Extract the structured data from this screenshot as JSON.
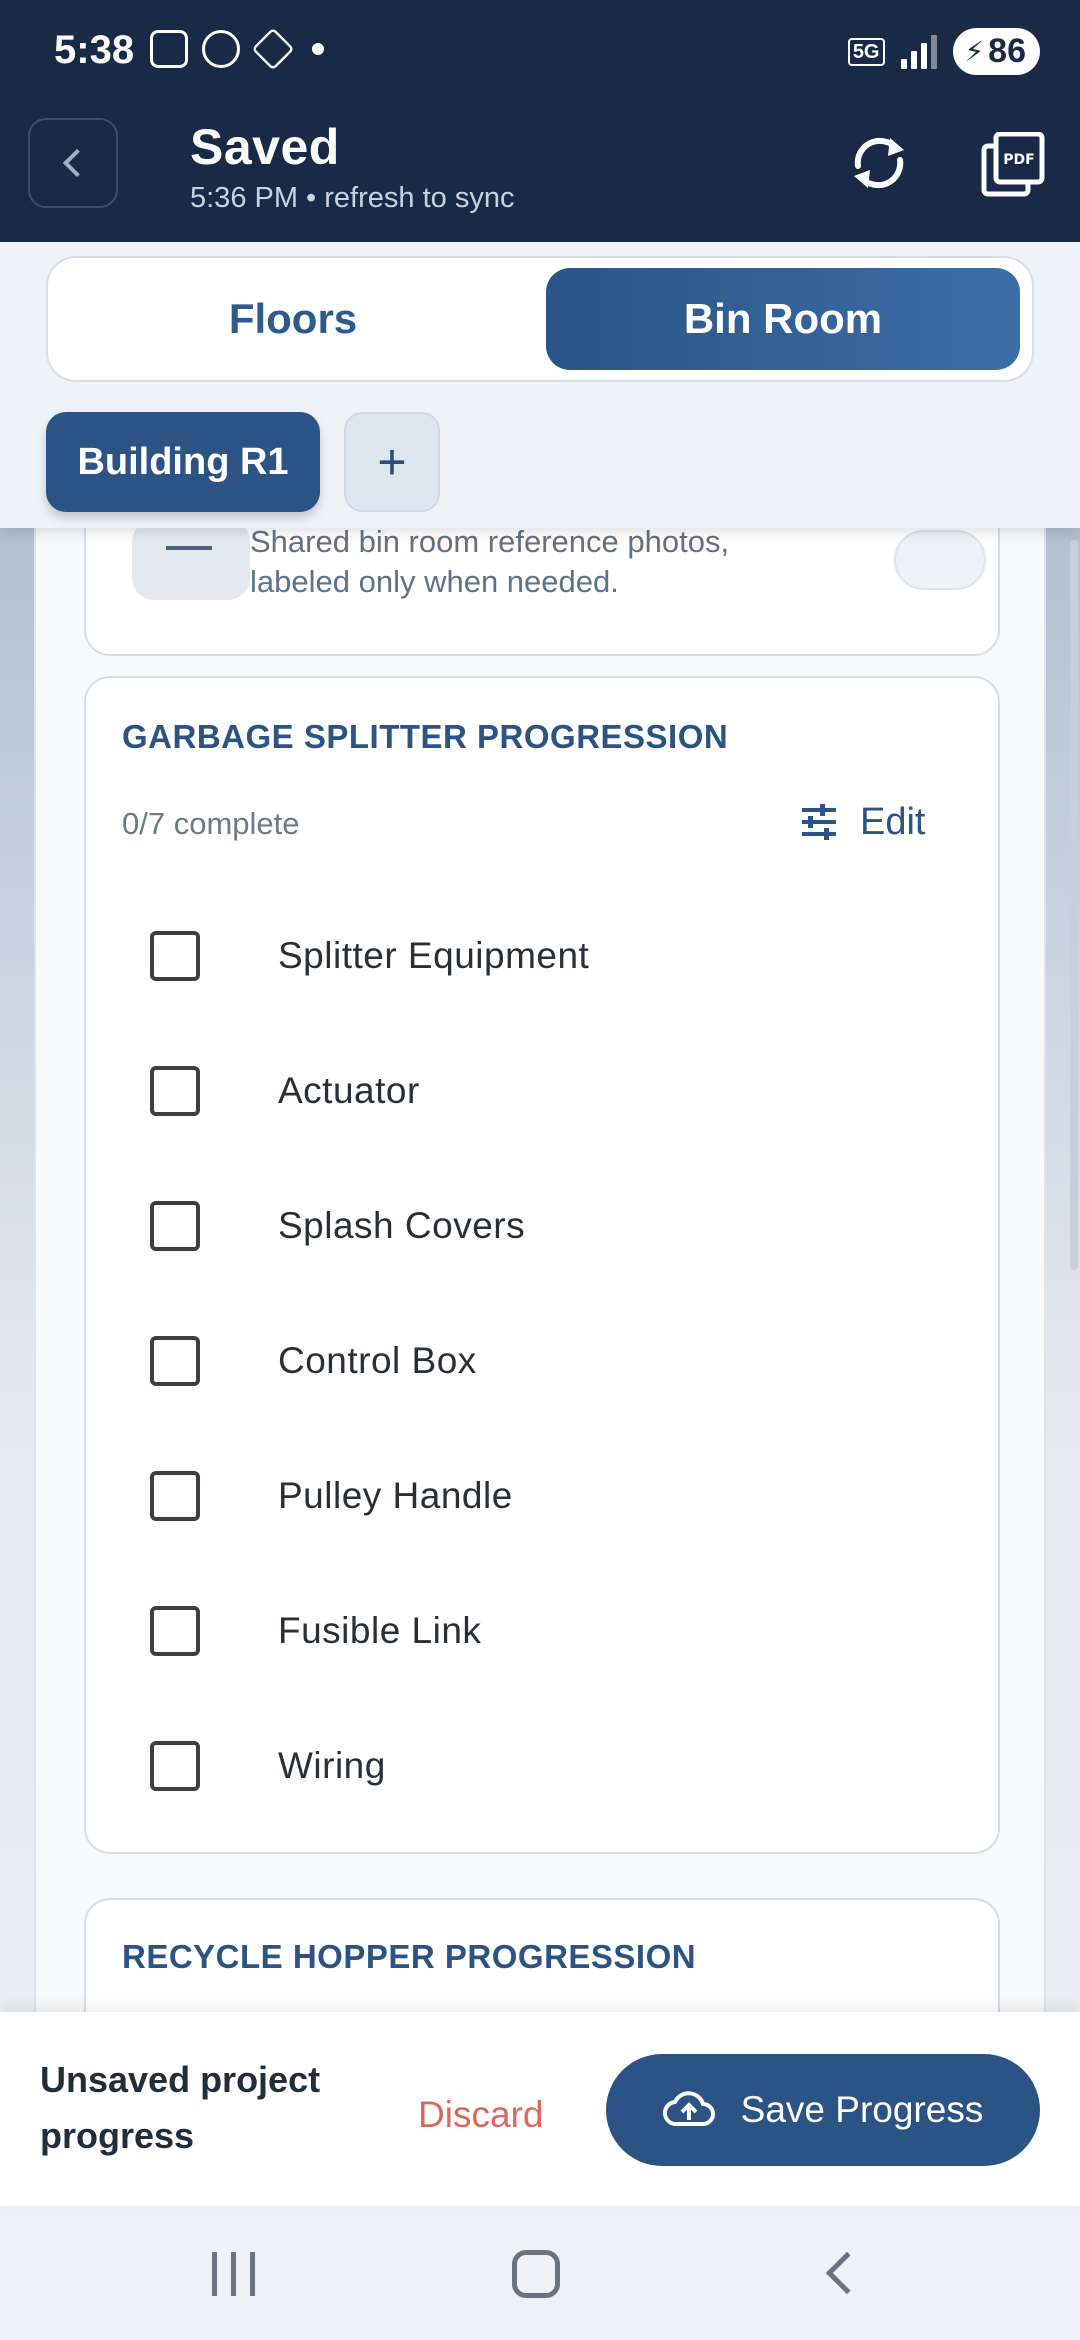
{
  "status_bar": {
    "time": "5:38",
    "network": "5G",
    "battery": "86"
  },
  "header": {
    "title": "Saved",
    "subtitle": "5:36 PM • refresh to sync",
    "sync_icon": "sync-icon",
    "pdf_icon": "pdf-icon",
    "pdf_label": "PDF"
  },
  "tabs": [
    {
      "label": "Floors",
      "selected": false
    },
    {
      "label": "Bin Room",
      "selected": true
    }
  ],
  "buildings": {
    "selected": "Building R1",
    "add_label": "+"
  },
  "reference_card": {
    "description": "Shared bin room reference photos, labeled only when needed."
  },
  "garbage_splitter": {
    "title": "GARBAGE SPLITTER PROGRESSION",
    "progress": "0/7 complete",
    "edit_label": "Edit",
    "items": [
      {
        "label": "Splitter Equipment",
        "checked": false
      },
      {
        "label": "Actuator",
        "checked": false
      },
      {
        "label": "Splash Covers",
        "checked": false
      },
      {
        "label": "Control Box",
        "checked": false
      },
      {
        "label": "Pulley Handle",
        "checked": false
      },
      {
        "label": "Fusible Link",
        "checked": false
      },
      {
        "label": "Wiring",
        "checked": false
      }
    ]
  },
  "recycle_hopper": {
    "title": "RECYCLE HOPPER PROGRESSION"
  },
  "save_bar": {
    "message": "Unsaved project progress",
    "discard_label": "Discard",
    "save_label": "Save Progress"
  },
  "colors": {
    "header_bg": "#182a45",
    "accent": "#2b5384",
    "discard": "#d9685f"
  }
}
